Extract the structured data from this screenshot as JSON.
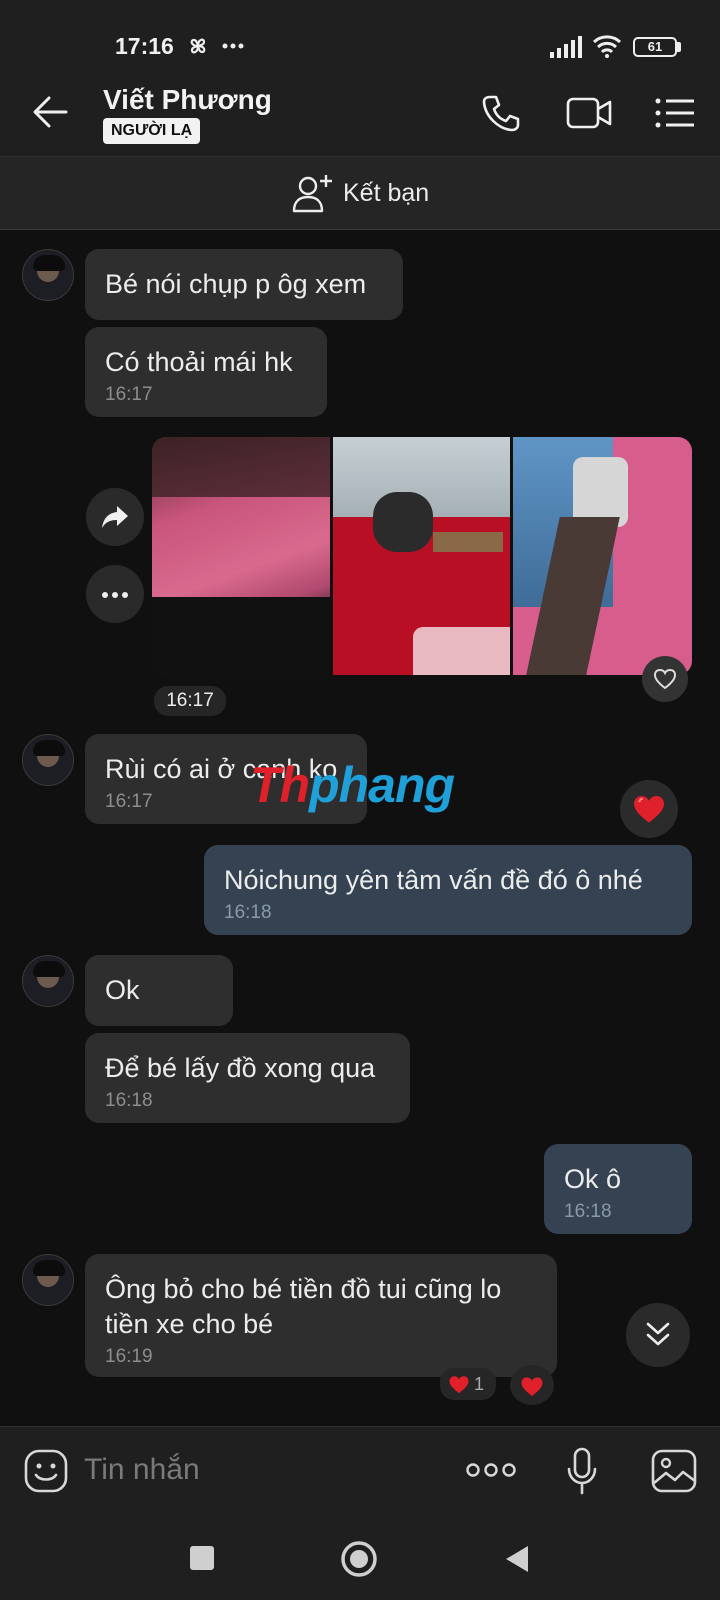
{
  "status_bar": {
    "time": "17:16",
    "battery": "61",
    "icons": [
      "pinwheel-icon",
      "more-dots-icon",
      "signal-icon",
      "wifi-icon",
      "battery-icon"
    ]
  },
  "header": {
    "contact_name": "Viết Phương",
    "badge": "NGƯỜI LẠ",
    "icons": [
      "back-arrow-icon",
      "phone-icon",
      "video-call-icon",
      "menu-list-icon"
    ]
  },
  "add_friend": {
    "label": "Kết bạn",
    "icon": "add-user-icon"
  },
  "messages": [
    {
      "from": "them",
      "text": "Bé nói chụp p ôg xem",
      "time": ""
    },
    {
      "from": "them",
      "text": "Có thoải mái hk",
      "time": "16:17"
    },
    {
      "from": "them",
      "type": "photos",
      "count": 3,
      "time": "16:17"
    },
    {
      "from": "them",
      "text": "Rùi có ai ở canh ko",
      "time": "16:17",
      "reaction": "❤️"
    },
    {
      "from": "me",
      "text": "Nóichung yên tâm vấn đề đó ô nhé",
      "time": "16:18"
    },
    {
      "from": "them",
      "text": "Ok",
      "time": ""
    },
    {
      "from": "them",
      "text": "Để bé lấy đồ xong qua",
      "time": "16:18"
    },
    {
      "from": "me",
      "text": "Ok ô",
      "time": "16:18"
    },
    {
      "from": "them",
      "text": "Ông bỏ cho bé tiền đồ tui cũng lo\ntiền xe cho bé",
      "time": "16:19",
      "reaction_count": "1"
    }
  ],
  "watermark": "Thphang",
  "input": {
    "placeholder": "Tin nhắn"
  },
  "colors": {
    "incoming_bubble": "#2e2e2e",
    "outgoing_bubble": "#344252",
    "background": "#101010",
    "reaction_heart": "#e0202a"
  }
}
